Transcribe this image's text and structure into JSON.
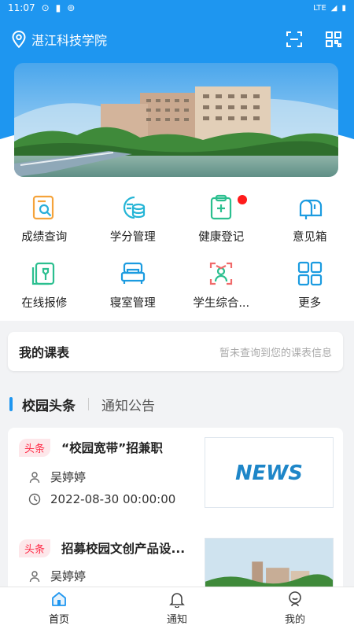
{
  "status_bar": {
    "time": "11:07",
    "network": "LTE"
  },
  "header": {
    "title": "湛江科技学院",
    "icons": [
      "location-icon",
      "scan-icon",
      "qrcode-icon"
    ]
  },
  "quick_menu": [
    {
      "label": "成绩查询",
      "icon": "grade-search-icon"
    },
    {
      "label": "学分管理",
      "icon": "credit-coins-icon"
    },
    {
      "label": "健康登记",
      "icon": "health-clipboard-icon",
      "badge": "red-dot"
    },
    {
      "label": "意见箱",
      "icon": "mailbox-icon"
    },
    {
      "label": "在线报修",
      "icon": "repair-icon"
    },
    {
      "label": "寝室管理",
      "icon": "bed-icon"
    },
    {
      "label": "学生综合...",
      "icon": "student-face-icon"
    },
    {
      "label": "更多",
      "icon": "grid-more-icon"
    }
  ],
  "schedule": {
    "title": "我的课表",
    "empty_text": "暂未查询到您的课表信息"
  },
  "tabs": {
    "active": "校园头条",
    "inactive": "通知公告"
  },
  "news": [
    {
      "tag": "头条",
      "title": "“校园宽带”招兼职",
      "author": "吴婷婷",
      "time": "2022-08-30 00:00:00",
      "thumb_text": "NEWS"
    },
    {
      "tag": "头条",
      "title": "招募校园文创产品设...",
      "author": "吴婷婷"
    }
  ],
  "bottom_nav": [
    {
      "label": "首页",
      "icon": "home-icon",
      "active": true
    },
    {
      "label": "通知",
      "icon": "bell-icon",
      "active": false
    },
    {
      "label": "我的",
      "icon": "profile-icon",
      "active": false
    }
  ],
  "colors": {
    "primary": "#1e96f0",
    "tag_red": "#ff2a46",
    "tag_bg": "#fde7ea"
  }
}
